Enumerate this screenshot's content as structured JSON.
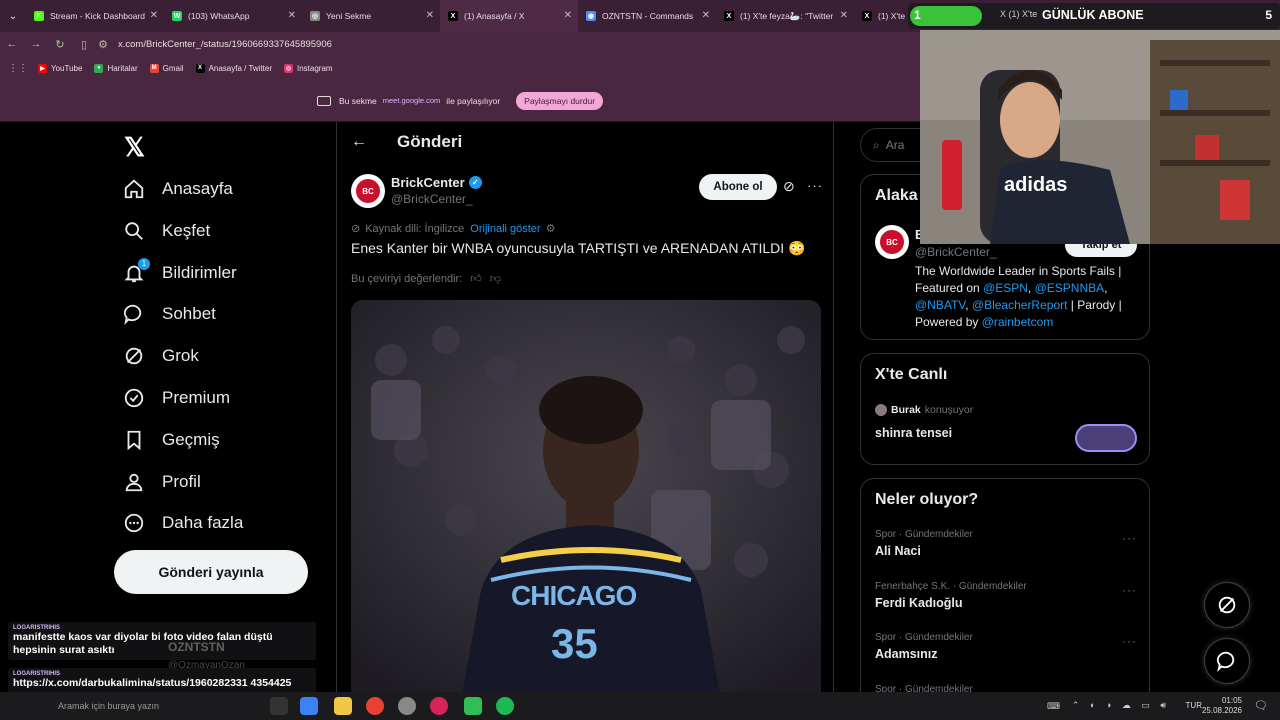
{
  "browser": {
    "tabs": [
      {
        "label": "Stream - Kick Dashboard",
        "fav": "K",
        "favColor": "#53fc18"
      },
      {
        "label": "(103) WhatsApp",
        "fav": "W",
        "favColor": "#25d366"
      },
      {
        "label": "Yeni Sekme",
        "fav": "◎",
        "favColor": "#888888"
      },
      {
        "label": "(1) Anasayfa / X",
        "fav": "X",
        "favColor": "#000000"
      },
      {
        "label": "OZNTSTN - Commands",
        "fav": "◉",
        "favColor": "#4a8cff"
      },
      {
        "label": "(1) X'te feyza🦢: \"Twitter",
        "fav": "X",
        "favColor": "#000000"
      },
      {
        "label": "(1) X'te I",
        "fav": "X",
        "favColor": "#000000"
      }
    ],
    "url": "x.com/BrickCenter_/status/1960669337645895906",
    "bookmarks": [
      {
        "label": "YouTube",
        "icon": "▶",
        "color": "#ff0000"
      },
      {
        "label": "Haritalar",
        "icon": "●",
        "color": "#34a853"
      },
      {
        "label": "Gmail",
        "icon": "M",
        "color": "#ea4335"
      },
      {
        "label": "Anasayfa / Twitter",
        "icon": "X",
        "color": "#000000"
      },
      {
        "label": "Instagram",
        "icon": "◎",
        "color": "#e1306c"
      }
    ],
    "share": {
      "prefix": "Bu sekme",
      "domain": "meet.google.com",
      "suffix": "ile paylaşılıyor",
      "stop": "Paylaşmayı durdur"
    }
  },
  "nav": {
    "items": [
      {
        "label": "Anasayfa",
        "icon": "home-icon"
      },
      {
        "label": "Keşfet",
        "icon": "search-icon"
      },
      {
        "label": "Bildirimler",
        "icon": "bell-icon"
      },
      {
        "label": "Sohbet",
        "icon": "chat-icon"
      },
      {
        "label": "Grok",
        "icon": "grok-icon"
      },
      {
        "label": "Premium",
        "icon": "premium-icon"
      },
      {
        "label": "Geçmiş",
        "icon": "bookmark-icon"
      },
      {
        "label": "Profil",
        "icon": "profile-icon"
      },
      {
        "label": "Daha fazla",
        "icon": "more-icon"
      }
    ],
    "notif_badge": "1",
    "post_button": "Gönderi yayınla"
  },
  "tweet": {
    "header": "Gönderi",
    "avatar_text": "BC",
    "name": "BrickCenter",
    "handle": "@BrickCenter_",
    "subscribe": "Abone ol",
    "source_lang": "Kaynak dili: İngilizce",
    "show_original": "Orijinali göster",
    "text": "Enes Kanter bir WNBA oyuncusuyla TARTIŞTI ve ARENADAN ATILDI 😳",
    "rate": "Bu çeviriyi değerlendir:",
    "jersey_team": "CHICAGO",
    "jersey_number": "35"
  },
  "right": {
    "search_placeholder": "Ara",
    "profile_card": {
      "title": "Alaka",
      "name_initial": "B",
      "handle": "@BrickCenter_",
      "follow": "Takip et",
      "bio_1": "The Worldwide Leader in Sports Fails |",
      "bio_2": "Featured on",
      "links": [
        "@ESPN",
        "@ESPNNBA",
        "@NBATV",
        "@BleacherReport",
        "@rainbetcom"
      ],
      "comma": ",",
      "sep": "|",
      "parody": "Parody |",
      "powered": "Powered by"
    },
    "live": {
      "title": "X'te Canlı",
      "host": "Burak",
      "status": "konuşuyor",
      "topic": "shinra tensei"
    },
    "whats": {
      "title": "Neler oluyor?",
      "trends": [
        {
          "category": "Spor · Gündemdekiler",
          "name": "Ali Naci"
        },
        {
          "category": "Fenerbahçe S.K. · Gündemdekiler",
          "name": "Ferdi Kadıoğlu"
        },
        {
          "category": "Spor · Gündemdekiler",
          "name": "Adamsınız"
        },
        {
          "category": "Spor · Gündemdekiler",
          "name": ""
        }
      ]
    }
  },
  "stream": {
    "subs_goal_current": "1",
    "subs_goal_label": "GÜNLÜK ABONE",
    "subs_goal_target": "5",
    "subs_goal_progress": 0.2,
    "cam_shirt": "adidas",
    "chat": [
      {
        "user": "LOGARISTRIHIS",
        "msg": "manifestte kaos var diyolar bi foto video falan düştü hepsinin surat asıktı"
      },
      {
        "user": "LOGARISTRIHIS",
        "msg": "https://x.com/darbukalimina/status/1960282331 4354425"
      }
    ],
    "ghost_name": "OZNTSTN",
    "ghost_handle": "@OzmayanOzan"
  },
  "taskbar": {
    "search": "Aramak için buraya yazın",
    "lang": "TUR",
    "time": "01:05",
    "date": "25.08.2026"
  }
}
